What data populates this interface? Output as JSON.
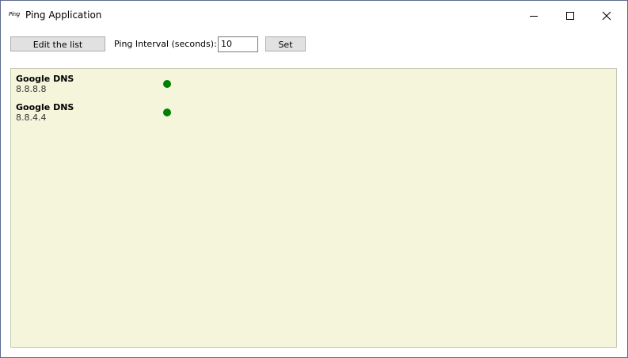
{
  "window": {
    "title": "Ping Application",
    "icon_text": "Ping",
    "controls": [
      "minimize-icon",
      "maximize-icon",
      "close-icon"
    ]
  },
  "toolbar": {
    "edit_label": "Edit the list",
    "interval_label": "Ping Interval (seconds):",
    "interval_value": "10",
    "set_label": "Set"
  },
  "hosts": [
    {
      "name": "Google DNS",
      "ip": "8.8.8.8",
      "status": "up"
    },
    {
      "name": "Google DNS",
      "ip": "8.8.4.4",
      "status": "up"
    }
  ],
  "colors": {
    "list_background": "#f5f5dc",
    "status_up": "#008000"
  }
}
